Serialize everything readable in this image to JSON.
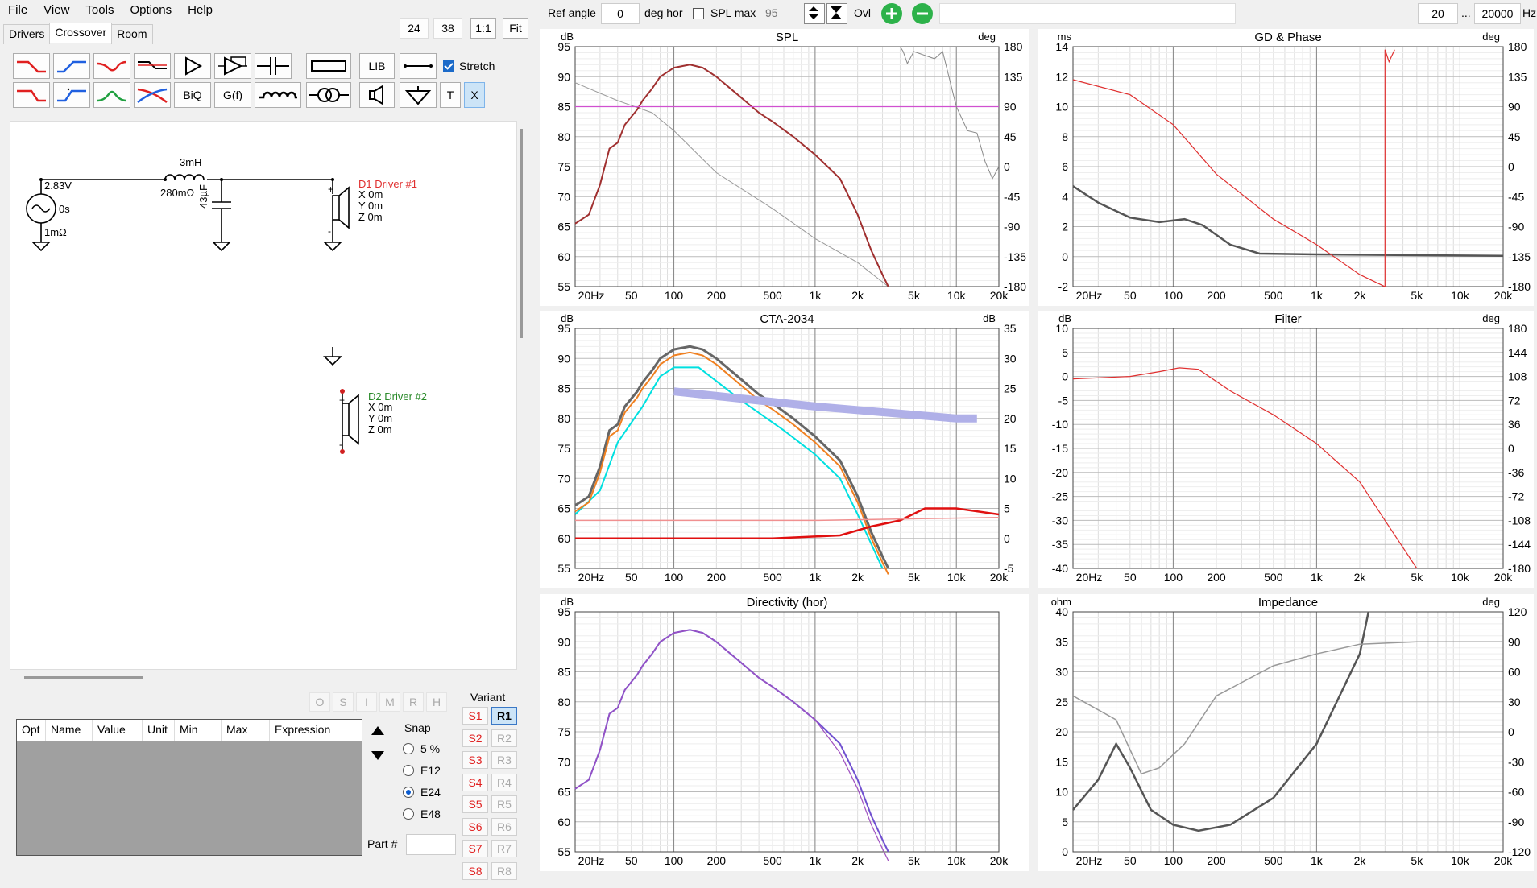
{
  "menu": [
    "File",
    "View",
    "Tools",
    "Options",
    "Help"
  ],
  "tabs": [
    "Drivers",
    "Crossover",
    "Room"
  ],
  "zoom_buttons": [
    "24",
    "38",
    "1:1",
    "Fit"
  ],
  "toolbar": {
    "lib_label": "LIB",
    "biq_label": "BiQ",
    "gf_label": "G(f)",
    "t_label": "T",
    "x_label": "X",
    "stretch_label": "Stretch",
    "stretch_checked": true,
    "icons": [
      "lowpass-icon",
      "highpass-icon",
      "bandpass-icon",
      "allpass-icon",
      "buffer-icon",
      "opamp-icon",
      "capacitor-icon",
      "resistor-icon",
      "wire-icon",
      "lowpass2-icon",
      "highpass2-icon",
      "bandpass2-icon",
      "crossover-icon",
      "inductor-icon",
      "transformer-icon",
      "speaker-icon",
      "ground-icon"
    ]
  },
  "circuit": {
    "source_voltage": "2.83V",
    "source_delay": "0s",
    "source_resistance": "1mΩ",
    "inductor_value": "3mH",
    "inductor_resistance": "280mΩ",
    "capacitor_value": "43µF",
    "driver1": {
      "name": "D1 Driver #1",
      "x": "X 0m",
      "y": "Y 0m",
      "z": "Z 0m",
      "color": "#e03030"
    },
    "driver2": {
      "name": "D2 Driver #2",
      "x": "X 0m",
      "y": "Y 0m",
      "z": "Z 0m",
      "color": "#2a8a2a"
    }
  },
  "bottom_letters": [
    "O",
    "S",
    "I",
    "M",
    "R",
    "H"
  ],
  "param_table": {
    "columns": [
      "Opt",
      "Name",
      "Value",
      "Unit",
      "Min",
      "Max",
      "Expression"
    ]
  },
  "snap": {
    "label": "Snap",
    "options": [
      "5 %",
      "E12",
      "E24",
      "E48"
    ],
    "selected": "E24"
  },
  "part_label": "Part #",
  "variant": {
    "label": "Variant",
    "s": [
      "S1",
      "S2",
      "S3",
      "S4",
      "S5",
      "S6",
      "S7",
      "S8"
    ],
    "r": [
      "R1",
      "R2",
      "R3",
      "R4",
      "R5",
      "R6",
      "R7",
      "R8"
    ],
    "selected": "R1"
  },
  "topbar": {
    "ref_angle_label": "Ref angle",
    "ref_angle_value": "0",
    "deg_hor_label": "deg hor",
    "spl_max_label": "SPL max",
    "spl_max_value": "95",
    "ovl_label": "Ovl",
    "freq_min": "20",
    "freq_sep": "...",
    "freq_max": "20000",
    "hz_label": "Hz"
  },
  "charts": {
    "spl": {
      "title": "SPL",
      "left_unit": "dB",
      "right_unit": "deg",
      "y": [
        "95",
        "90",
        "85",
        "80",
        "75",
        "70",
        "65",
        "60",
        "55"
      ],
      "y2": [
        "180",
        "135",
        "90",
        "45",
        "0",
        "-45",
        "-90",
        "-135",
        "-180"
      ]
    },
    "gd": {
      "title": "GD & Phase",
      "left_unit": "ms",
      "right_unit": "deg",
      "y": [
        "14",
        "12",
        "10",
        "8",
        "6",
        "4",
        "2",
        "0",
        "-2"
      ],
      "y2": [
        "180",
        "135",
        "90",
        "45",
        "0",
        "-45",
        "-90",
        "-135",
        "-180"
      ]
    },
    "cta": {
      "title": "CTA-2034",
      "left_unit": "dB",
      "right_unit": "dB",
      "y": [
        "95",
        "90",
        "85",
        "80",
        "75",
        "70",
        "65",
        "60",
        "55"
      ],
      "y2": [
        "35",
        "30",
        "25",
        "20",
        "15",
        "10",
        "5",
        "0",
        "-5"
      ]
    },
    "filter": {
      "title": "Filter",
      "left_unit": "dB",
      "right_unit": "deg",
      "y": [
        "10",
        "5",
        "0",
        "-5",
        "-10",
        "-15",
        "-20",
        "-25",
        "-30",
        "-35",
        "-40"
      ],
      "y2": [
        "180",
        "144",
        "108",
        "72",
        "36",
        "0",
        "-36",
        "-72",
        "-108",
        "-144",
        "-180"
      ]
    },
    "dir": {
      "title": "Directivity (hor)",
      "left_unit": "dB",
      "right_unit": "",
      "y": [
        "95",
        "90",
        "85",
        "80",
        "75",
        "70",
        "65",
        "60",
        "55"
      ],
      "y2": []
    },
    "imp": {
      "title": "Impedance",
      "left_unit": "ohm",
      "right_unit": "deg",
      "y": [
        "40",
        "35",
        "30",
        "25",
        "20",
        "15",
        "10",
        "5",
        "0"
      ],
      "y2": [
        "120",
        "90",
        "60",
        "30",
        "0",
        "-30",
        "-60",
        "-90",
        "-120"
      ]
    }
  },
  "x_ticks": [
    "20Hz",
    "50",
    "100",
    "200",
    "500",
    "1k",
    "2k",
    "5k",
    "10k",
    "20k"
  ]
}
